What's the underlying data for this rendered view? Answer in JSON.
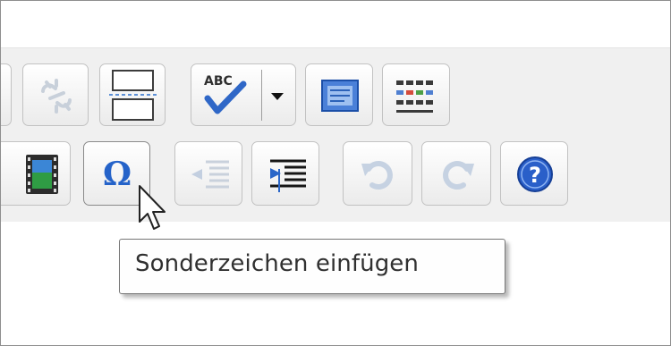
{
  "toolbar": {
    "row1": [
      {
        "name": "unlink-button",
        "icon": "unlink-icon",
        "enabled": false
      },
      {
        "name": "horizontal-rule-button",
        "icon": "horizontal-rule-icon",
        "enabled": true
      },
      {
        "name": "spellcheck-button",
        "icon": "spellcheck-abc-icon",
        "icon_text": "ABC",
        "enabled": true
      },
      {
        "name": "spellcheck-dropdown-button",
        "icon": "dropdown-arrow-icon",
        "enabled": true
      },
      {
        "name": "blockquote-button",
        "icon": "blockquote-icon",
        "enabled": true
      },
      {
        "name": "table-button",
        "icon": "table-icon",
        "enabled": true
      }
    ],
    "row2": [
      {
        "name": "insert-media-button",
        "icon": "film-strip-icon",
        "enabled": true
      },
      {
        "name": "special-character-button",
        "icon": "omega-icon",
        "icon_text": "Ω",
        "enabled": true,
        "hovered": true
      },
      {
        "name": "outdent-button",
        "icon": "outdent-icon",
        "enabled": false
      },
      {
        "name": "indent-button",
        "icon": "indent-icon",
        "enabled": true
      },
      {
        "name": "undo-button",
        "icon": "undo-icon",
        "enabled": false
      },
      {
        "name": "redo-button",
        "icon": "redo-icon",
        "enabled": false
      },
      {
        "name": "help-button",
        "icon": "help-icon",
        "icon_text": "?",
        "enabled": true
      }
    ]
  },
  "tooltip": {
    "text": "Sonderzeichen einfügen"
  },
  "colors": {
    "toolbar_bg": "#f0f0f0",
    "accent_blue": "#2563c9",
    "disabled_icon": "#c9d3df"
  }
}
